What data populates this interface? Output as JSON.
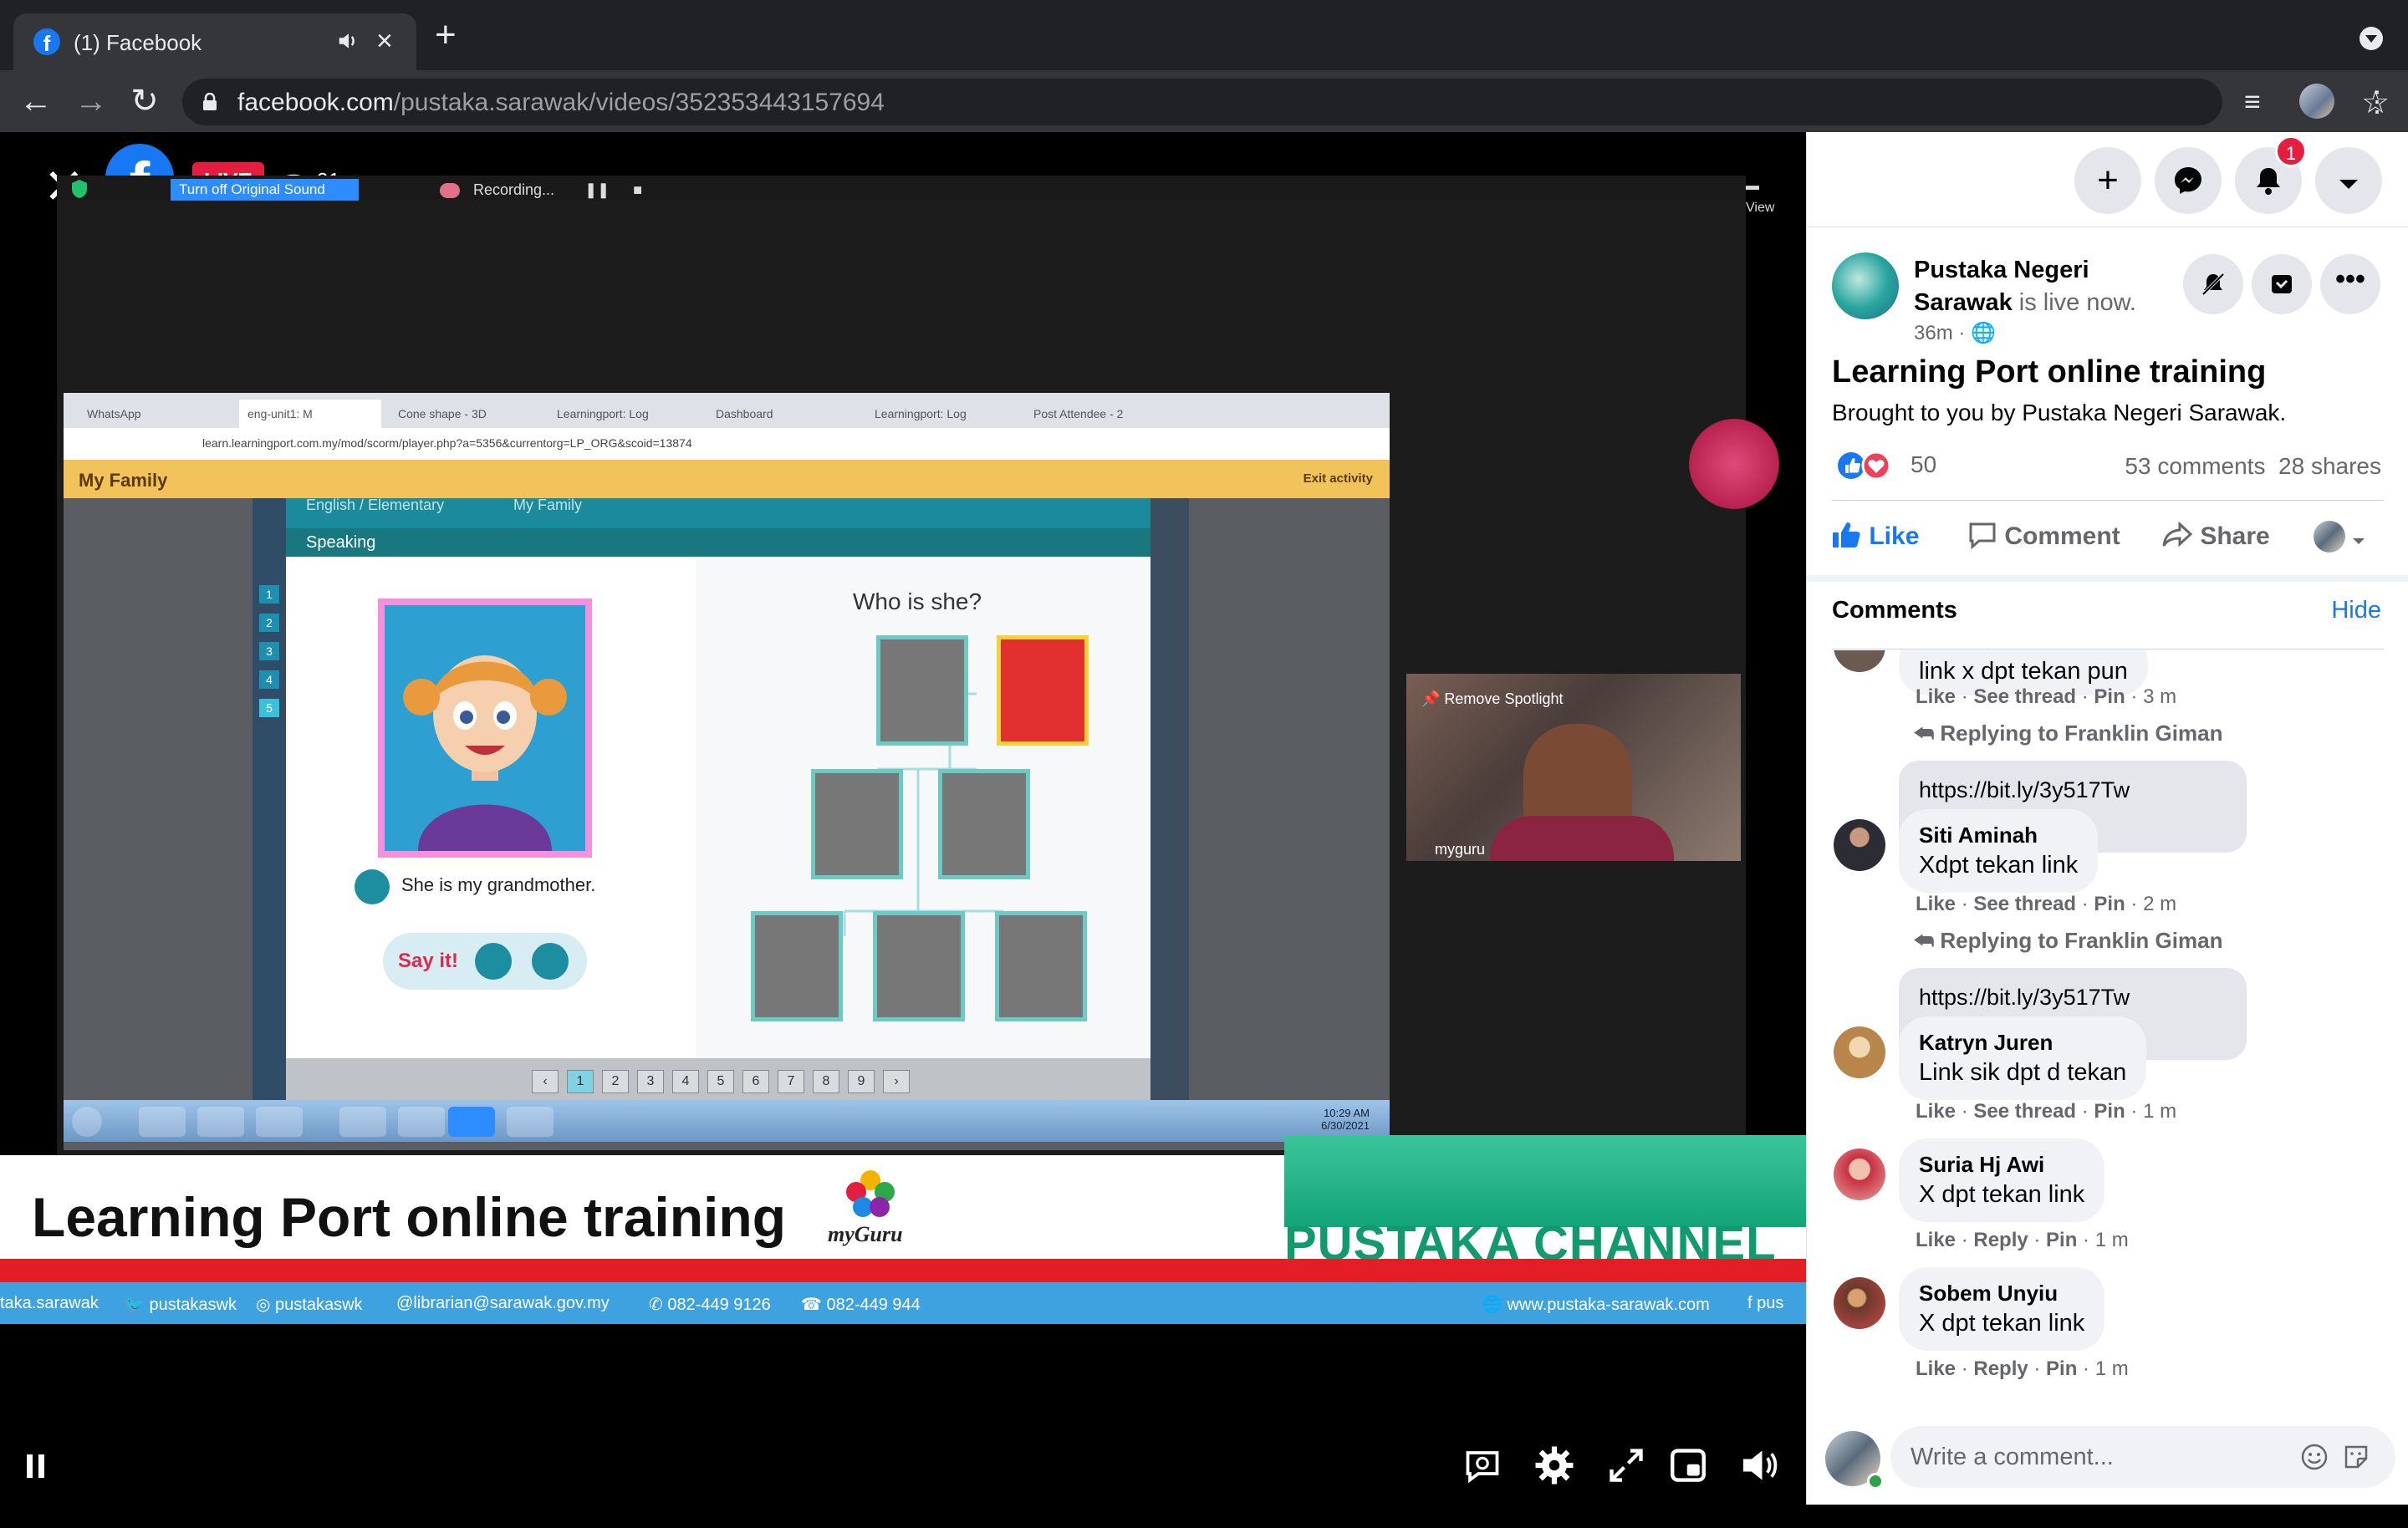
{
  "browser": {
    "tab_title": "(1) Facebook",
    "url_host": "facebook.com",
    "url_path": "/pustaka.sarawak/videos/352353443157694"
  },
  "video": {
    "live_label": "LIVE",
    "viewer_count": "61",
    "zoom": {
      "sound_button": "Turn off Original Sound",
      "recording": "Recording...",
      "view": "View"
    },
    "lesson": {
      "app_title": "My Family",
      "exit": "Exit activity",
      "url": "learn.learningport.com.my/mod/scorm/player.php?a=5356&currentorg=LP_ORG&scoid=13874",
      "tabs": [
        "WhatsApp",
        "eng-unit1: M",
        "Cone shape - 3D",
        "Learningport: Log",
        "Dashboard",
        "Learningport: Log",
        "Post Attendee - 2"
      ],
      "breadcrumb_1": "English / Elementary",
      "breadcrumb_2": "My Family",
      "section": "Speaking",
      "caption": "She is my grandmother.",
      "say_it": "Say it!",
      "question": "Who is she?",
      "side_numbers": [
        "1",
        "2",
        "3",
        "4",
        "5"
      ],
      "pages": [
        "1",
        "2",
        "3",
        "4",
        "5",
        "6",
        "7",
        "8",
        "9"
      ],
      "time": "10:29 AM",
      "date": "6/30/2021"
    },
    "camera": {
      "spotlight": "Remove Spotlight",
      "name": "myguru"
    },
    "lower_third": {
      "title": "Learning Port online training",
      "myguru": "myGuru",
      "channel": "PUSTAKA CHANNEL",
      "socials": [
        "taka.sarawak",
        "pustakaswk",
        "pustakaswk",
        "librarian@sarawak.gov.my",
        "082-449 9126",
        "082-449 944",
        "www.pustaka-sarawak.com",
        "pus"
      ]
    }
  },
  "panel": {
    "notification_count": "1",
    "page_name": "Pustaka Negeri Sarawak",
    "live_status": "is live now.",
    "time": "36m ·",
    "title": "Learning Port online training",
    "description": "Brought to you by Pustaka Negeri Sarawak.",
    "reaction_count": "50",
    "comments_count": "53 comments",
    "shares_count": "28 shares",
    "actions": {
      "like": "Like",
      "comment": "Comment",
      "share": "Share"
    },
    "comments_heading": "Comments",
    "hide": "Hide",
    "comments": [
      {
        "name": "",
        "text": "link x dpt tekan pun",
        "like": "Like",
        "action": "See thread",
        "pin": "Pin",
        "time": "3 m",
        "reply_to": "Replying to Franklin Giman"
      },
      {
        "name": "Siti Aminah",
        "link": "https://bit.ly/3y517Tw",
        "text": "Xdpt tekan link",
        "like": "Like",
        "action": "See thread",
        "pin": "Pin",
        "time": "2 m",
        "reply_to": "Replying to Franklin Giman"
      },
      {
        "name": "Katryn Juren",
        "link": "https://bit.ly/3y517Tw",
        "text": "Link sik dpt d tekan",
        "like": "Like",
        "action": "See thread",
        "pin": "Pin",
        "time": "1 m"
      },
      {
        "name": "Suria Hj Awi",
        "text": "X dpt tekan link",
        "like": "Like",
        "action": "Reply",
        "pin": "Pin",
        "time": "1 m"
      },
      {
        "name": "Sobem Unyiu",
        "text": "X dpt tekan link",
        "like": "Like",
        "action": "Reply",
        "pin": "Pin",
        "time": "1 m"
      }
    ],
    "composer_placeholder": "Write a comment..."
  }
}
